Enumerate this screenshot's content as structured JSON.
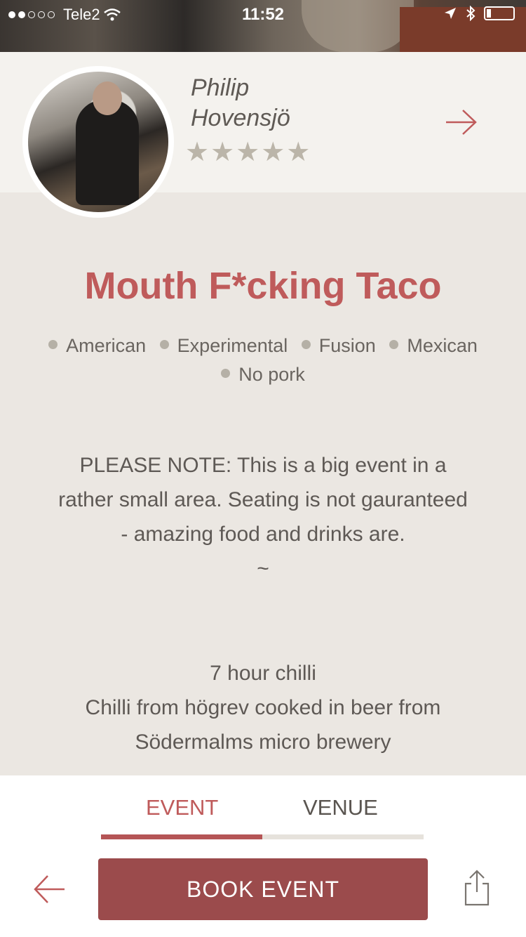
{
  "status_bar": {
    "carrier": "Tele2",
    "time": "11:52"
  },
  "host": {
    "name_first": "Philip",
    "name_last": "Hovensjö",
    "rating": 5,
    "stars": "★★★★★"
  },
  "event": {
    "title": "Mouth F*cking Taco",
    "tags": [
      "American",
      "Experimental",
      "Fusion",
      "Mexican",
      "No pork"
    ],
    "description": "PLEASE NOTE: This is a big event in a rather small area. Seating is not gauranteed - amazing food and drinks are.",
    "separator": "~",
    "menu_item_title": "7 hour chilli",
    "menu_item_desc": "Chilli from högrev cooked in beer from Södermalms micro brewery"
  },
  "tabs": {
    "event": "EVENT",
    "venue": "VENUE",
    "active": "event"
  },
  "actions": {
    "book": "BOOK EVENT"
  },
  "colors": {
    "accent": "#bf5b5b",
    "button": "#9b4b4c",
    "background": "#ebe7e2",
    "panel": "#f4f2ee"
  }
}
